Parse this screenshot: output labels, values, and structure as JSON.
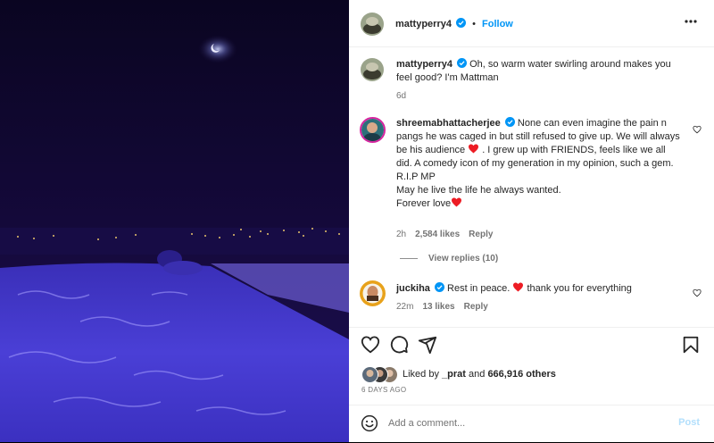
{
  "post": {
    "username": "mattyperry4",
    "follow_label": "Follow",
    "dot": "•",
    "caption": {
      "username": "mattyperry4",
      "text": "Oh, so warm water swirling around makes you feel good? I'm Mattman",
      "time": "6d"
    },
    "comments": [
      {
        "username": "shreemabhattacherjee",
        "lines": [
          "None can even imagine the pain n pangs he was caged in but still refused to give up. We will always be his audience",
          ". I grew up with FRIENDS, feels like we all did. A comedy icon of my generation in my opinion, such a gem.",
          "R.I.P MP",
          "May he live the life he always wanted.",
          "Forever love"
        ],
        "time": "2h",
        "likes": "2,584 likes",
        "reply": "Reply",
        "view_replies": "View replies (10)"
      },
      {
        "username": "juckiha",
        "text_before": "Rest in peace.",
        "text_after": "thank you for everything",
        "time": "22m",
        "likes": "13 likes",
        "reply": "Reply"
      }
    ],
    "likes_line": {
      "prefix": "Liked by",
      "user": "_prat",
      "and": "and",
      "count": "666,916 others"
    },
    "date": "6 DAYS AGO",
    "add_comment_placeholder": "Add a comment...",
    "post_label": "Post",
    "colors": {
      "accent": "#0095f6",
      "post_disabled": "#b2dffc",
      "heart_red": "#ed1c24",
      "photo_sky": "#0b0624",
      "photo_water": "#4b3fd9"
    },
    "icons": [
      "verified-badge-icon",
      "more-options-icon",
      "heart-icon",
      "comment-icon",
      "share-icon",
      "bookmark-icon",
      "emoji-icon"
    ]
  }
}
